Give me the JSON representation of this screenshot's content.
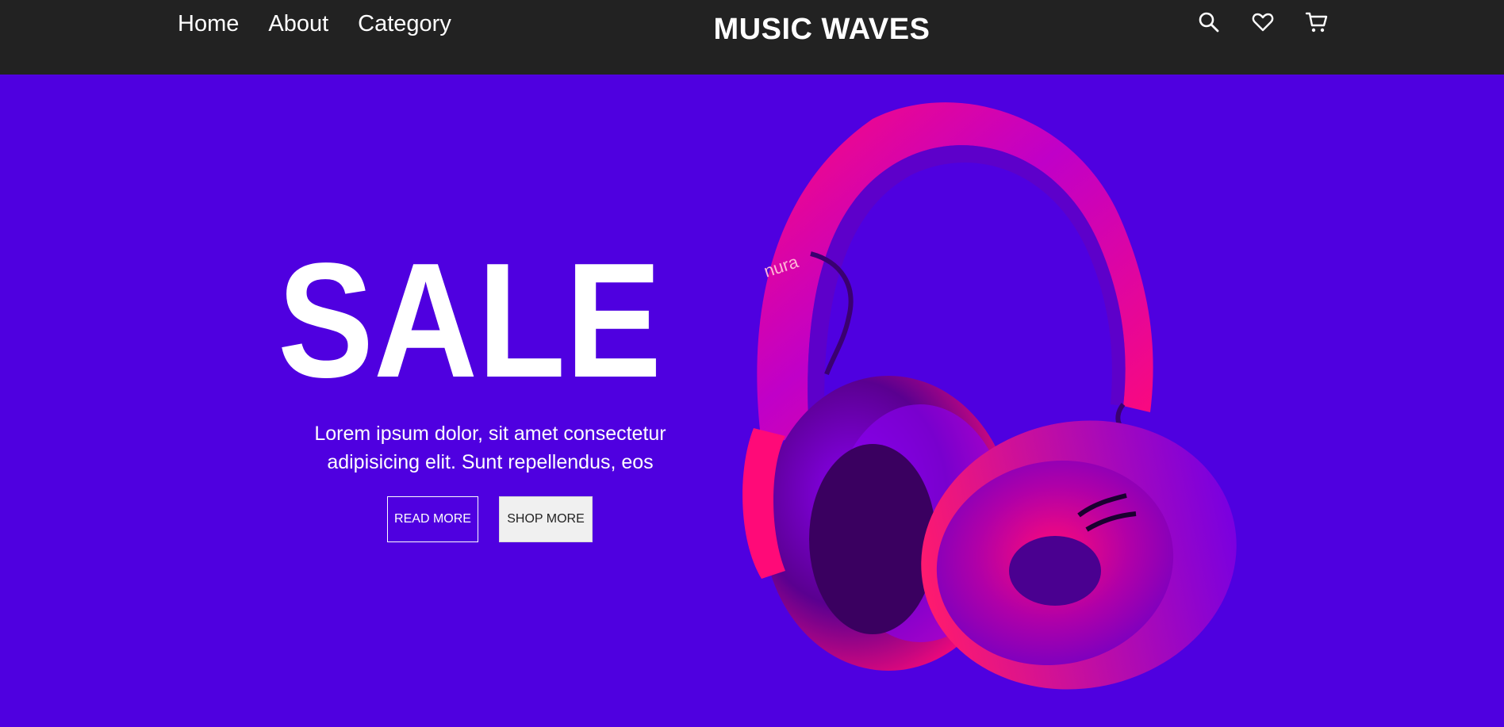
{
  "nav": {
    "links": [
      "Home",
      "About",
      "Category"
    ],
    "brand": "MUSIC WAVES",
    "icons": [
      "search-icon",
      "heart-icon",
      "cart-icon"
    ]
  },
  "hero": {
    "headline": "SALE",
    "description": "Lorem ipsum dolor, sit amet consectetur adipisicing elit. Sunt repellendus, eos",
    "read_more_label": "READ MORE",
    "shop_more_label": "SHOP MORE",
    "product_brand_mark": "nura"
  },
  "colors": {
    "navbar_bg": "#222222",
    "hero_bg": "#4f00e0",
    "headphone_pink": "#ff0a78",
    "headphone_purple": "#8a00f0",
    "text": "#ffffff"
  }
}
